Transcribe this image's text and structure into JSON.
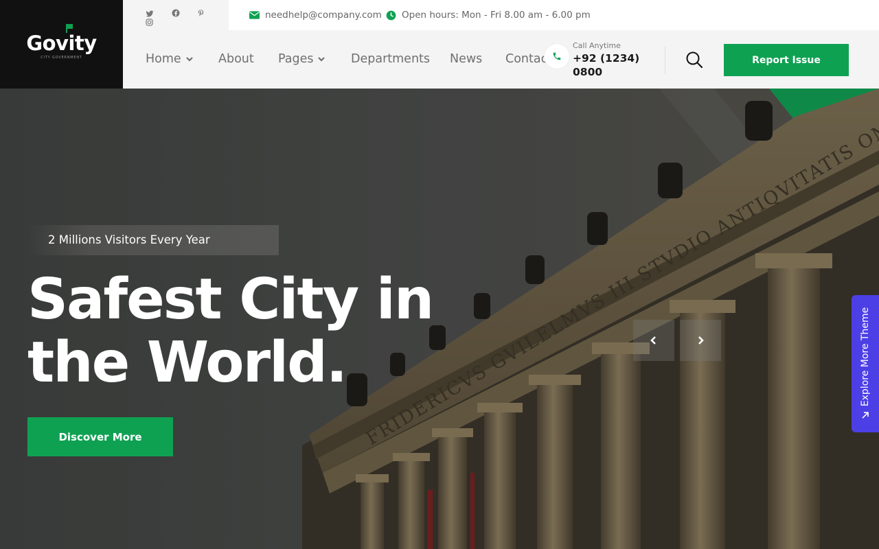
{
  "brand": {
    "name": "Govity",
    "tagline": "CITY GOVERNMENT",
    "accent": "#0fa152",
    "explore_color": "#4d3fe6"
  },
  "topbar": {
    "social": [
      "twitter-icon",
      "facebook-icon",
      "pinterest-icon",
      "instagram-icon"
    ],
    "email": "needhelp@company.com",
    "hours": "Open hours: Mon - Fri 8.00 am - 6.00 pm"
  },
  "nav": {
    "items": [
      {
        "label": "Home",
        "has_dropdown": true
      },
      {
        "label": "About",
        "has_dropdown": false
      },
      {
        "label": "Pages",
        "has_dropdown": true
      },
      {
        "label": "Departments",
        "has_dropdown": false
      },
      {
        "label": "News",
        "has_dropdown": false
      },
      {
        "label": "Contact",
        "has_dropdown": false
      }
    ]
  },
  "call": {
    "small": "Call Anytime",
    "number_line1": "+92 (1234)",
    "number_line2": "0800"
  },
  "actions": {
    "report_label": "Report Issue"
  },
  "hero": {
    "badge": "2 Millions Visitors Every Year",
    "headline_line1": "Safest City in",
    "headline_line2": "the World.",
    "cta": "Discover More",
    "inscription": "FRIDERICVS GVILELMVS III STVDIO ANTIQVITATIS OMNIGENAE"
  },
  "side_tab": {
    "label": "Explore More Theme"
  }
}
